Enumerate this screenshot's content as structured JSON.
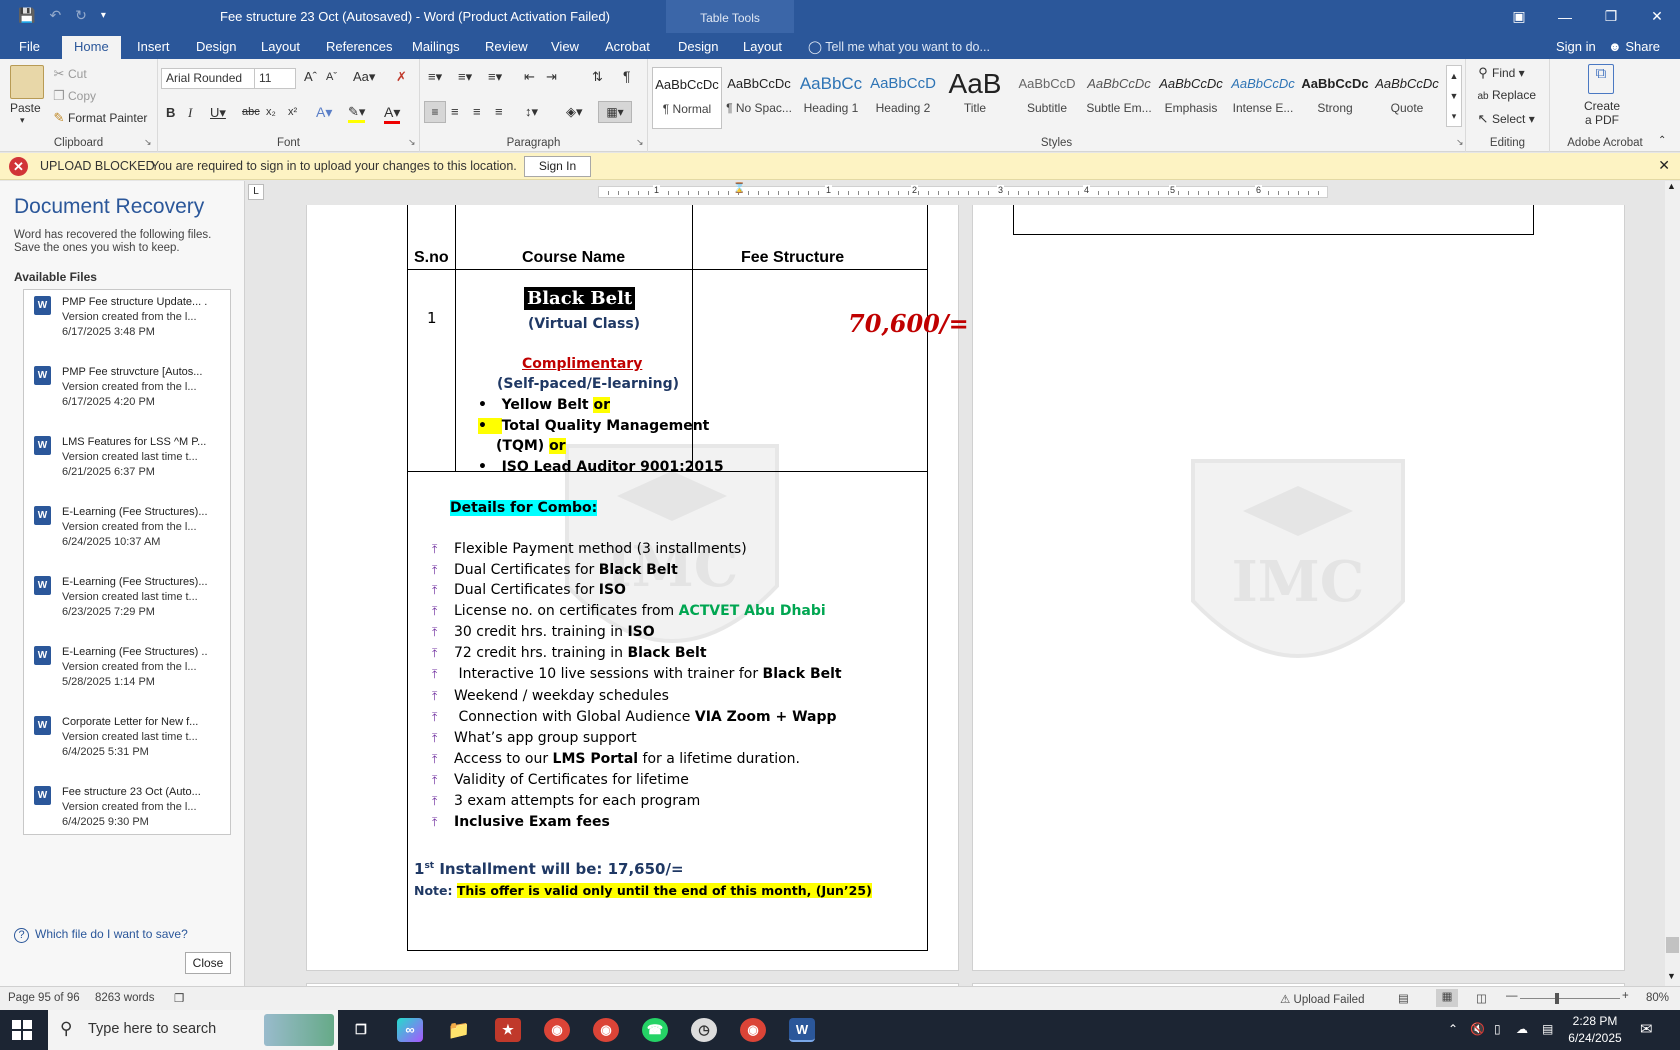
{
  "titlebar": {
    "doc_title": "Fee structure 23 Oct (Autosaved) - Word (Product Activation Failed)",
    "table_tools": "Table Tools"
  },
  "tabs": [
    "File",
    "Home",
    "Insert",
    "Design",
    "Layout",
    "References",
    "Mailings",
    "Review",
    "View",
    "Acrobat",
    "Design",
    "Layout"
  ],
  "tell_me": "Tell me what you want to do...",
  "sign_in": "Sign in",
  "share": "Share",
  "ribbon": {
    "clipboard": {
      "label": "Clipboard",
      "paste": "Paste",
      "cut": "Cut",
      "copy": "Copy",
      "format_painter": "Format Painter"
    },
    "font": {
      "label": "Font",
      "family": "Arial Rounded",
      "size": "11"
    },
    "paragraph": {
      "label": "Paragraph"
    },
    "styles": {
      "label": "Styles",
      "items": [
        {
          "preview": "AaBbCcDc",
          "name": "¶ Normal"
        },
        {
          "preview": "AaBbCcDc",
          "name": "¶ No Spac..."
        },
        {
          "preview": "AaBbCc",
          "name": "Heading 1"
        },
        {
          "preview": "AaBbCcD",
          "name": "Heading 2"
        },
        {
          "preview": "AaB",
          "name": "Title"
        },
        {
          "preview": "AaBbCcD",
          "name": "Subtitle"
        },
        {
          "preview": "AaBbCcDc",
          "name": "Subtle Em..."
        },
        {
          "preview": "AaBbCcDc",
          "name": "Emphasis"
        },
        {
          "preview": "AaBbCcDc",
          "name": "Intense E..."
        },
        {
          "preview": "AaBbCcDc",
          "name": "Strong"
        },
        {
          "preview": "AaBbCcDc",
          "name": "Quote"
        }
      ]
    },
    "editing": {
      "label": "Editing",
      "find": "Find",
      "replace": "Replace",
      "select": "Select"
    },
    "acrobat": {
      "label": "Adobe Acrobat",
      "create_pdf_1": "Create",
      "create_pdf_2": "a PDF"
    }
  },
  "message_bar": {
    "title": "UPLOAD BLOCKED",
    "text": "You are required to sign in to upload your changes to this location.",
    "button": "Sign In"
  },
  "recovery": {
    "title": "Document Recovery",
    "subtitle": "Word has recovered the following files. Save the ones you wish to keep.",
    "available": "Available Files",
    "files": [
      {
        "name": "PMP Fee structure Update... .",
        "desc": "Version created from the l...",
        "date": "6/17/2025 3:48 PM"
      },
      {
        "name": "PMP Fee struvcture  [Autos...",
        "desc": "Version created from the l...",
        "date": "6/17/2025 4:20 PM"
      },
      {
        "name": "LMS Features for LSS ^M P...",
        "desc": "Version created last time t...",
        "date": "6/21/2025 6:37 PM"
      },
      {
        "name": "E-Learning (Fee Structures)...",
        "desc": "Version created from the l...",
        "date": "6/24/2025 10:37 AM"
      },
      {
        "name": "E-Learning (Fee Structures)...",
        "desc": "Version created last time t...",
        "date": "6/23/2025 7:29 PM"
      },
      {
        "name": "E-Learning (Fee Structures) ..",
        "desc": "Version created from the l...",
        "date": "5/28/2025 1:14 PM"
      },
      {
        "name": "Corporate Letter for New f...",
        "desc": "Version created last time t...",
        "date": "6/4/2025 5:31 PM"
      },
      {
        "name": "Fee structure 23 Oct (Auto...",
        "desc": "Version created from the l...",
        "date": "6/4/2025 9:30 PM"
      }
    ],
    "help": "Which file do I want to save?",
    "close": "Close"
  },
  "document": {
    "headers": {
      "sno": "S.no",
      "course": "Course Name",
      "fee": "Fee Structure"
    },
    "row_no": "1",
    "black_belt": "Black Belt",
    "virtual": "(Virtual Class)",
    "price": "70,600/=",
    "complimentary": "Complimentary",
    "self_paced": "(Self-paced/E-learning)",
    "yellow_belt": "Yellow Belt ",
    "or": "or",
    "tqm_1": "Total Quality Management",
    "tqm_2": "(TQM) ",
    "iso": "ISO Lead Auditor 9001:2015",
    "combo_title": "Details for Combo:",
    "details": [
      {
        "pre": "Flexible Payment method (3 installments)",
        "bold": "",
        "post": ""
      },
      {
        "pre": "Dual Certificates for ",
        "bold": "Black Belt",
        "post": ""
      },
      {
        "pre": "Dual Certificates for ",
        "bold": "ISO",
        "post": ""
      },
      {
        "pre": "License no. on certificates from ",
        "green": "ACTVET Abu Dhabi",
        "post": ""
      },
      {
        "pre": "30 credit hrs. training in ",
        "bold": "ISO",
        "post": ""
      },
      {
        "pre": "72 credit hrs. training in ",
        "bold": "Black Belt",
        "post": ""
      },
      {
        "pre": " Interactive 10 live sessions with trainer for ",
        "bold": "Black Belt",
        "post": ""
      },
      {
        "pre": "Weekend / weekday schedules",
        "bold": "",
        "post": ""
      },
      {
        "pre": " Connection with Global Audience ",
        "bold": "VIA Zoom + Wapp",
        "post": ""
      },
      {
        "pre": "What’s app group support",
        "bold": "",
        "post": ""
      },
      {
        "pre": "Access to our ",
        "bold": "LMS Portal",
        "post": " for a lifetime duration."
      },
      {
        "pre": "Validity of Certificates for lifetime",
        "bold": "",
        "post": ""
      },
      {
        "pre": "3 exam attempts for each program",
        "bold": "",
        "post": ""
      },
      {
        "pre": "",
        "bold": "Inclusive Exam fees",
        "post": ""
      }
    ],
    "installment_pre": "1",
    "installment_sup": "st",
    "installment_post": " Installment will be: 17,650/=",
    "note_label": "Note: ",
    "note_text": "This offer is valid only until the end of this month, (Jun’25)",
    "watermark": "IMC"
  },
  "ruler_numbers": [
    "1",
    "1",
    "2",
    "3",
    "4",
    "5",
    "6"
  ],
  "status": {
    "page": "Page 95 of 96",
    "words": "8263 words",
    "upload": "Upload Failed",
    "zoom": "80%"
  },
  "taskbar": {
    "search": "Type here to search",
    "time": "2:28 PM",
    "date": "6/24/2025"
  }
}
